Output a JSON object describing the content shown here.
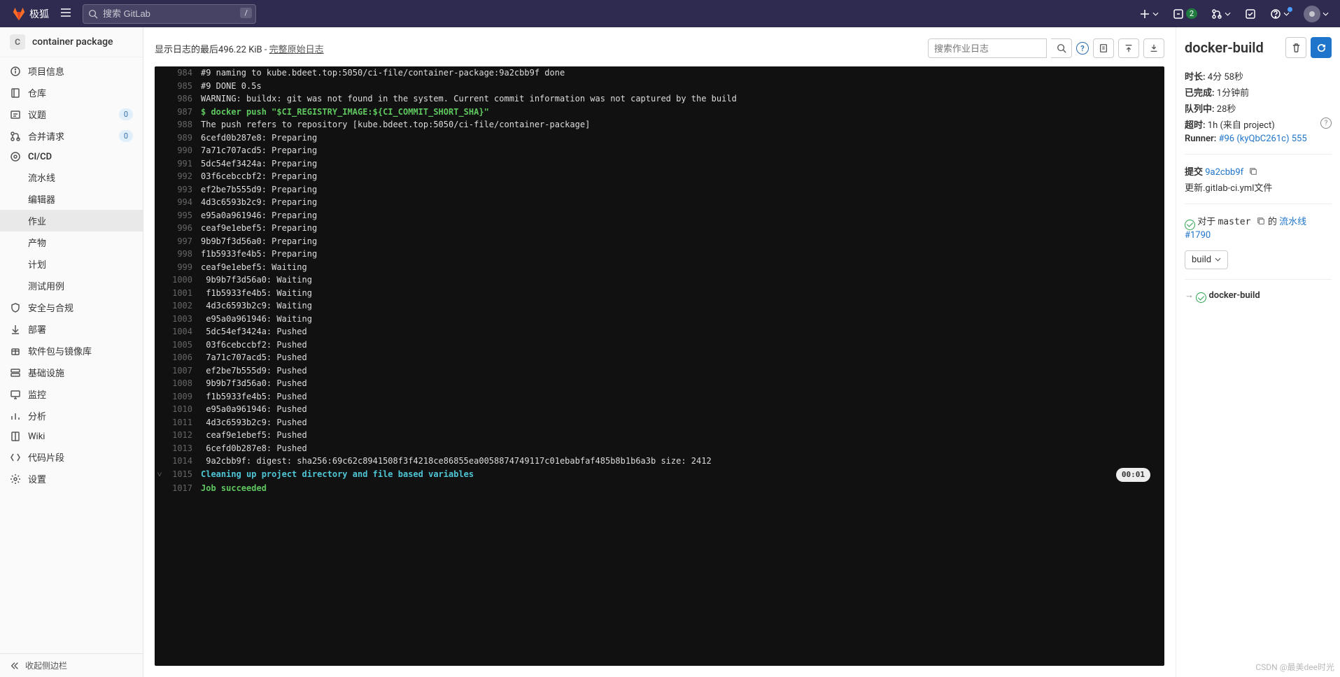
{
  "header": {
    "brand": "极狐",
    "search_placeholder": "搜索 GitLab",
    "search_kbd": "/",
    "mr_count": "2"
  },
  "sidebar": {
    "project_initial": "C",
    "project_name": "container package",
    "items": [
      {
        "label": "项目信息",
        "icon": "info"
      },
      {
        "label": "仓库",
        "icon": "repo"
      },
      {
        "label": "议题",
        "icon": "issues",
        "badge": "0"
      },
      {
        "label": "合并请求",
        "icon": "mr",
        "badge": "0"
      },
      {
        "label": "CI/CD",
        "icon": "cicd",
        "bold": true
      }
    ],
    "sub": [
      {
        "label": "流水线"
      },
      {
        "label": "编辑器"
      },
      {
        "label": "作业",
        "active": true
      },
      {
        "label": "产物"
      },
      {
        "label": "计划"
      },
      {
        "label": "测试用例"
      }
    ],
    "items2": [
      {
        "label": "安全与合规",
        "icon": "shield"
      },
      {
        "label": "部署",
        "icon": "deploy"
      },
      {
        "label": "软件包与镜像库",
        "icon": "package"
      },
      {
        "label": "基础设施",
        "icon": "infra"
      },
      {
        "label": "监控",
        "icon": "monitor"
      },
      {
        "label": "分析",
        "icon": "analytics"
      },
      {
        "label": "Wiki",
        "icon": "wiki"
      },
      {
        "label": "代码片段",
        "icon": "snippet"
      },
      {
        "label": "设置",
        "icon": "settings"
      }
    ],
    "collapse": "收起侧边栏"
  },
  "log": {
    "header_prefix": "显示日志的最后",
    "header_size": "496.22 KiB",
    "header_raw": "完整原始日志",
    "search_placeholder": "搜索作业日志",
    "timer": "00:01",
    "lines": [
      {
        "n": 984,
        "t": "#9 naming to kube.bdeet.top:5050/ci-file/container-package:9a2cbb9f done"
      },
      {
        "n": 985,
        "t": "#9 DONE 0.5s"
      },
      {
        "n": 986,
        "t": "WARNING: buildx: git was not found in the system. Current commit information was not captured by the build"
      },
      {
        "n": 987,
        "t": "$ docker push \"$CI_REGISTRY_IMAGE:${CI_COMMIT_SHORT_SHA}\"",
        "cls": "green bold"
      },
      {
        "n": 988,
        "t": "The push refers to repository [kube.bdeet.top:5050/ci-file/container-package]"
      },
      {
        "n": 989,
        "t": "6cefd0b287e8: Preparing"
      },
      {
        "n": 990,
        "t": "7a71c707acd5: Preparing"
      },
      {
        "n": 991,
        "t": "5dc54ef3424a: Preparing"
      },
      {
        "n": 992,
        "t": "03f6cebccbf2: Preparing"
      },
      {
        "n": 993,
        "t": "ef2be7b555d9: Preparing"
      },
      {
        "n": 994,
        "t": "4d3c6593b2c9: Preparing"
      },
      {
        "n": 995,
        "t": "e95a0a961946: Preparing"
      },
      {
        "n": 996,
        "t": "ceaf9e1ebef5: Preparing"
      },
      {
        "n": 997,
        "t": "9b9b7f3d56a0: Preparing"
      },
      {
        "n": 998,
        "t": "f1b5933fe4b5: Preparing"
      },
      {
        "n": 999,
        "t": "ceaf9e1ebef5: Waiting"
      },
      {
        "n": 1000,
        "t": " 9b9b7f3d56a0: Waiting"
      },
      {
        "n": 1001,
        "t": " f1b5933fe4b5: Waiting"
      },
      {
        "n": 1002,
        "t": " 4d3c6593b2c9: Waiting"
      },
      {
        "n": 1003,
        "t": " e95a0a961946: Waiting"
      },
      {
        "n": 1004,
        "t": " 5dc54ef3424a: Pushed"
      },
      {
        "n": 1005,
        "t": " 03f6cebccbf2: Pushed"
      },
      {
        "n": 1006,
        "t": " 7a71c707acd5: Pushed"
      },
      {
        "n": 1007,
        "t": " ef2be7b555d9: Pushed"
      },
      {
        "n": 1008,
        "t": " 9b9b7f3d56a0: Pushed"
      },
      {
        "n": 1009,
        "t": " f1b5933fe4b5: Pushed"
      },
      {
        "n": 1010,
        "t": " e95a0a961946: Pushed"
      },
      {
        "n": 1011,
        "t": " 4d3c6593b2c9: Pushed"
      },
      {
        "n": 1012,
        "t": " ceaf9e1ebef5: Pushed"
      },
      {
        "n": 1013,
        "t": " 6cefd0b287e8: Pushed"
      },
      {
        "n": 1014,
        "t": " 9a2cbb9f: digest: sha256:69c62c8941508f3f4218ce86855ea0058874749117c01ebabfaf485b8b1b6a3b size: 2412"
      },
      {
        "n": 1015,
        "t": "Cleaning up project directory and file based variables",
        "cls": "cyan bold",
        "chev": true,
        "timer": true
      },
      {
        "n": 1017,
        "t": "Job succeeded",
        "cls": "green bold"
      }
    ]
  },
  "detail": {
    "title": "docker-build",
    "duration_label": "时长:",
    "duration": "4分 58秒",
    "finished_label": "已完成:",
    "finished": "1分钟前",
    "queued_label": "队列中:",
    "queued": "28秒",
    "timeout_label": "超时:",
    "timeout": "1h (来自 project)",
    "runner_label": "Runner:",
    "runner": "#96 (kyQbC261c) 555",
    "commit_label": "提交",
    "commit_sha": "9a2cbb9f",
    "commit_msg": "更新.gitlab-ci.yml文件",
    "branch_prefix": "对于",
    "branch": "master",
    "pipeline_mid": "的",
    "pipeline_link": "流水线 #1790",
    "stage": "build",
    "job_name": "docker-build"
  },
  "watermark": "CSDN @最美dee时光"
}
